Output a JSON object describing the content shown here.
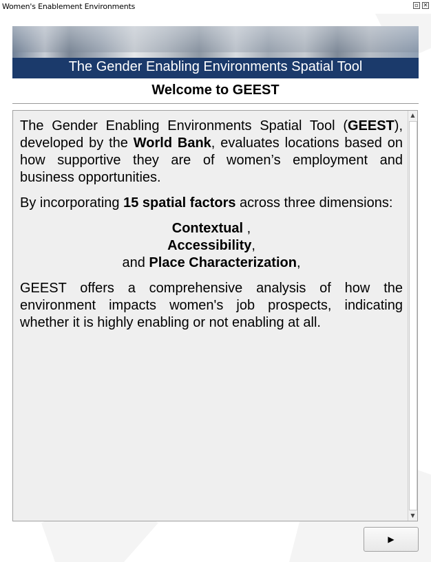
{
  "window": {
    "title": "Women's Enablement Environments",
    "float_icon": "float-icon",
    "close_icon": "close-icon"
  },
  "banner": {
    "title": "The Gender Enabling Environments Spatial Tool"
  },
  "welcome": {
    "heading": "Welcome to GEEST"
  },
  "intro": {
    "p1_a": "The Gender Enabling Environments Spatial Tool (",
    "p1_b": "GEEST",
    "p1_c": "), developed by the ",
    "p1_d": "World Bank",
    "p1_e": ", evaluates locations based on how supportive they are of women’s employment and business opportunities.",
    "p2_a": "By incorporating ",
    "p2_b": "15 spatial factors",
    "p2_c": " across three dimensions:",
    "dim1": "Contextual",
    "dim1_suffix": " ,",
    "dim2": "Accessibility",
    "dim2_suffix": ",",
    "dim3_prefix": "and ",
    "dim3": "Place Characterization",
    "dim3_suffix": ",",
    "p3": "GEEST offers a comprehensive analysis of how the environment impacts women's job prospects, indicating whether it is highly enabling or not enabling at all."
  },
  "navigation": {
    "next_icon": "play-arrow-icon",
    "next_glyph": "▶"
  }
}
